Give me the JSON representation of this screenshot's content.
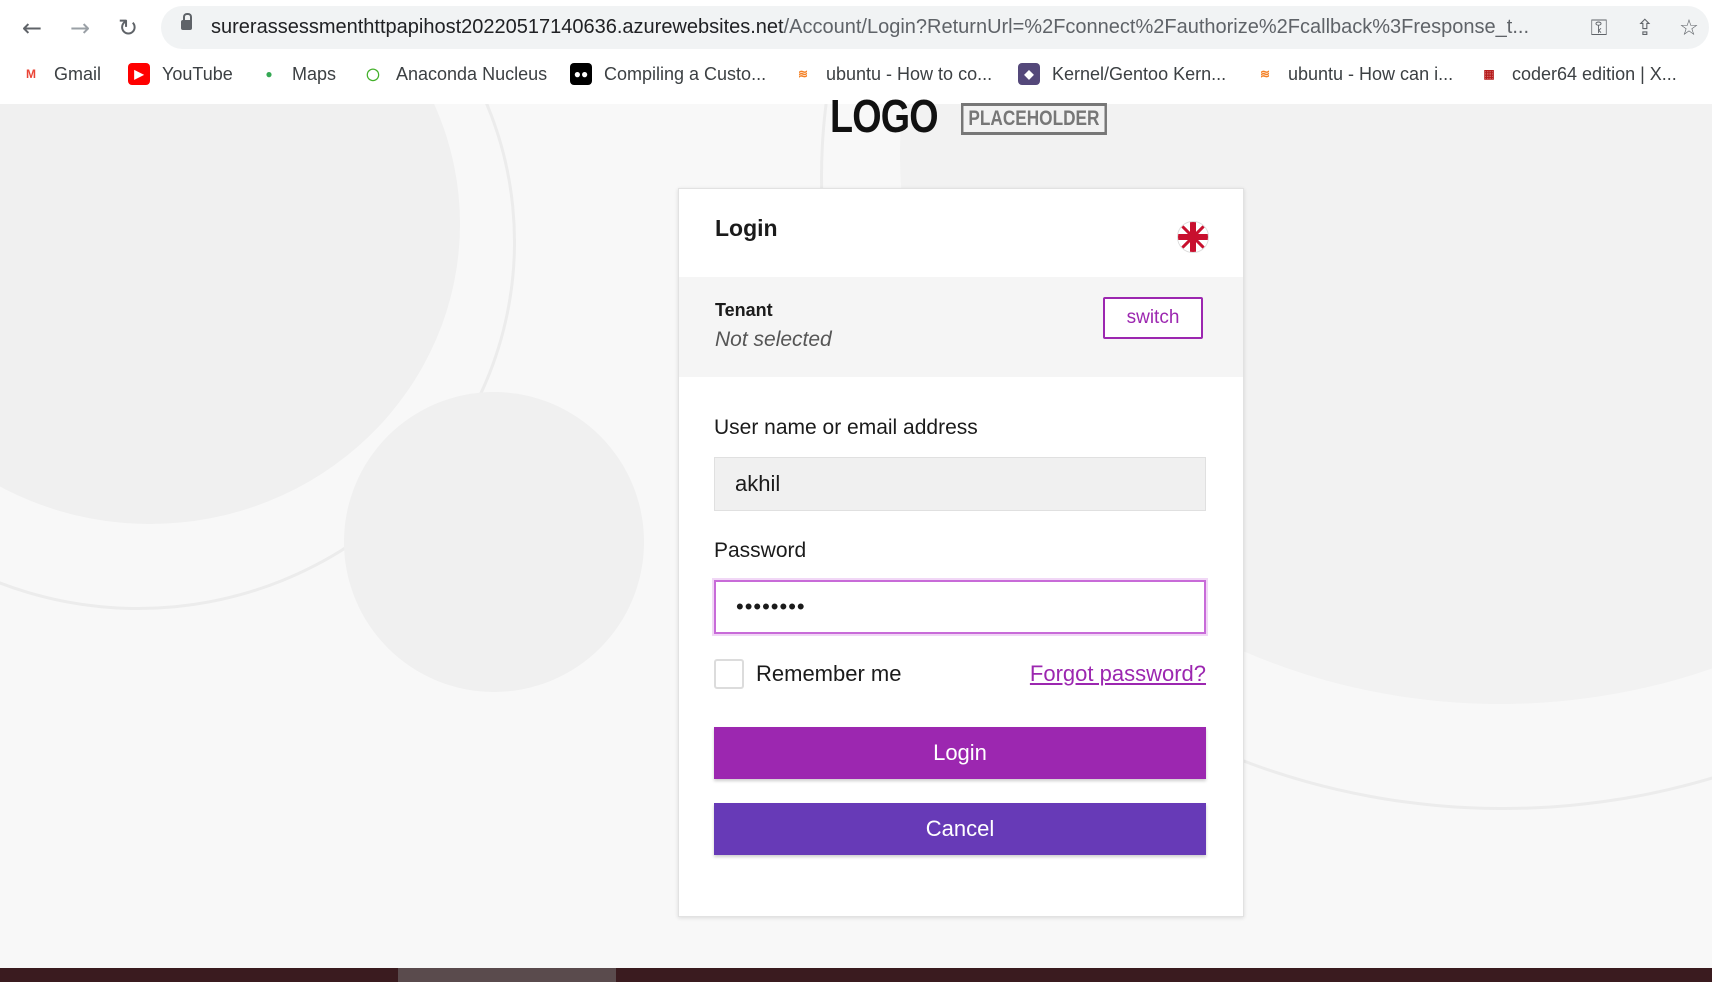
{
  "browser": {
    "back_icon": "←",
    "forward_icon": "→",
    "reload_icon": "↻",
    "url_host": "surerassessmenthttpapihost20220517140636.azurewebsites.net",
    "url_path": "/Account/Login?ReturnUrl=%2Fconnect%2Fauthorize%2Fcallback%3Fresponse_t...",
    "key_icon": "⚿",
    "share_icon": "⇪",
    "star_icon": "☆",
    "bookmarks": [
      {
        "label": "Gmail",
        "icon": "M",
        "icon_color": "#ea4335",
        "icon_bg": "transparent"
      },
      {
        "label": "YouTube",
        "icon": "▶",
        "icon_color": "#ffffff",
        "icon_bg": "#ff0000"
      },
      {
        "label": "Maps",
        "icon": "●",
        "icon_color": "#34a853",
        "icon_bg": "transparent"
      },
      {
        "label": "Anaconda Nucleus",
        "icon": "◯",
        "icon_color": "#43b02a",
        "icon_bg": "transparent"
      },
      {
        "label": "Compiling a Custo...",
        "icon": "●●",
        "icon_color": "#ffffff",
        "icon_bg": "#000000"
      },
      {
        "label": "ubuntu - How to co...",
        "icon": "≋",
        "icon_color": "#f48024",
        "icon_bg": "transparent"
      },
      {
        "label": "Kernel/Gentoo Kern...",
        "icon": "◆",
        "icon_color": "#ffffff",
        "icon_bg": "#54487a"
      },
      {
        "label": "ubuntu - How can i...",
        "icon": "≋",
        "icon_color": "#f48024",
        "icon_bg": "transparent"
      },
      {
        "label": "coder64 edition | X...",
        "icon": "▦",
        "icon_color": "#b71c1c",
        "icon_bg": "transparent"
      }
    ]
  },
  "logo": {
    "main": "LOGO",
    "sub": "PLACEHOLDER"
  },
  "login": {
    "title": "Login",
    "language_flag": "uk-flag-icon",
    "tenant_label": "Tenant",
    "tenant_value": "Not selected",
    "switch_label": "switch",
    "username_label": "User name or email address",
    "username_value": "akhil",
    "password_label": "Password",
    "password_value": "••••••••",
    "remember_label": "Remember me",
    "forgot_label": "Forgot password?",
    "login_label": "Login",
    "cancel_label": "Cancel"
  },
  "colors": {
    "primary": "#9c27b0",
    "secondary": "#673ab7"
  }
}
